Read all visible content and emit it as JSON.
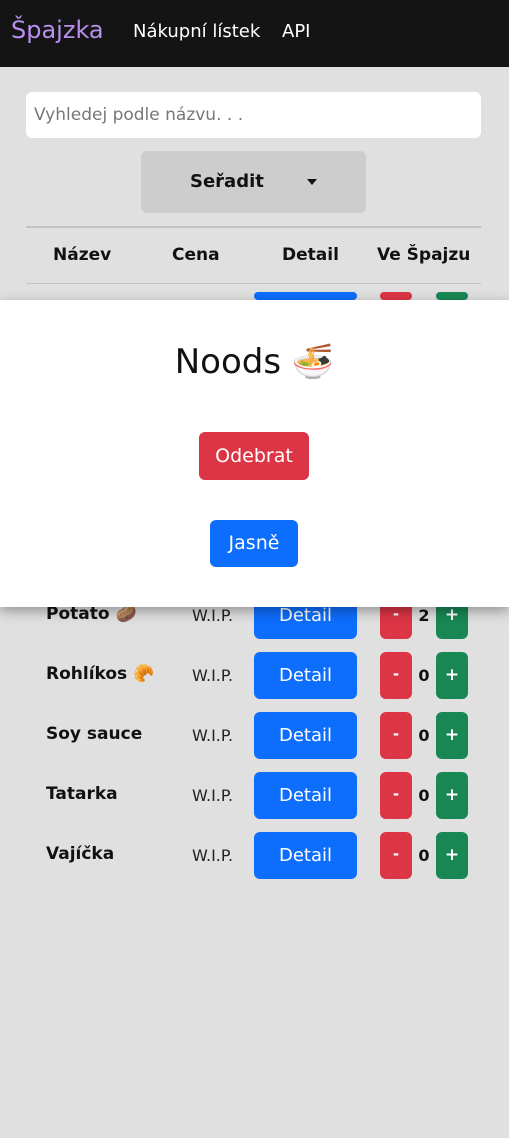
{
  "navbar": {
    "brand": "Špajzka",
    "links": [
      "Nákupní lístek",
      "API"
    ]
  },
  "search": {
    "placeholder": "Vyhledej podle názvu. . ."
  },
  "sort": {
    "label": "Seřadit"
  },
  "table": {
    "headers": [
      "Název",
      "Cena",
      "Detail",
      "Ve Špajzu"
    ],
    "rows": [
      {
        "name": "Potato 🥔",
        "price": "W.I.P.",
        "detail": "Detail",
        "minus": "-",
        "qty": "2",
        "plus": "+"
      },
      {
        "name": "Rohlíkos 🥐",
        "price": "W.I.P.",
        "detail": "Detail",
        "minus": "-",
        "qty": "0",
        "plus": "+"
      },
      {
        "name": "Soy sauce",
        "price": "W.I.P.",
        "detail": "Detail",
        "minus": "-",
        "qty": "0",
        "plus": "+"
      },
      {
        "name": "Tatarka",
        "price": "W.I.P.",
        "detail": "Detail",
        "minus": "-",
        "qty": "0",
        "plus": "+"
      },
      {
        "name": "Vajíčka",
        "price": "W.I.P.",
        "detail": "Detail",
        "minus": "-",
        "qty": "0",
        "plus": "+"
      }
    ]
  },
  "modal": {
    "title": "Noods 🍜",
    "remove_label": "Odebrat",
    "ok_label": "Jasně"
  },
  "colors": {
    "navbar": "#141414",
    "brand": "#b98ff0",
    "primary": "#0d6efd",
    "danger": "#dc3545",
    "success": "#198754",
    "background": "#e0e0e0"
  }
}
